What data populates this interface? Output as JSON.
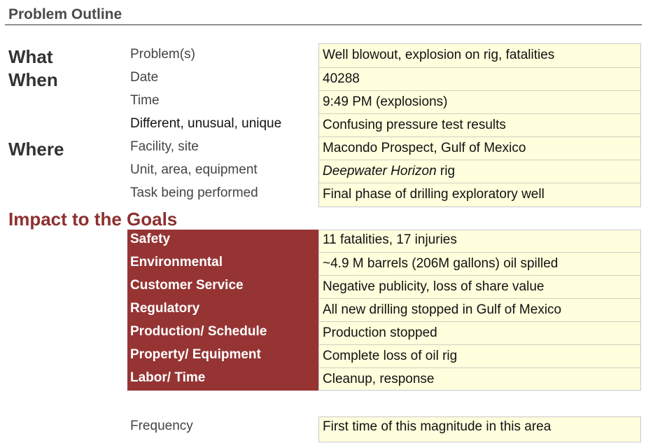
{
  "title": "Problem Outline",
  "sections": {
    "what": "What",
    "when": "When",
    "where": "Where"
  },
  "outline": [
    {
      "label": "Problem(s)",
      "value": "Well blowout, explosion on rig, fatalities"
    },
    {
      "label": "Date",
      "value": "40288"
    },
    {
      "label": "Time",
      "value": "9:49 PM (explosions)"
    },
    {
      "label": "Different, unusual, unique",
      "value": "Confusing pressure test results"
    },
    {
      "label": "Facility, site",
      "value": "Macondo Prospect, Gulf of Mexico"
    },
    {
      "label": "Unit, area, equipment",
      "value_italic": "Deepwater Horizon",
      "value": " rig"
    },
    {
      "label": "Task being performed",
      "value": "Final phase of drilling exploratory well"
    }
  ],
  "goals_heading": "Impact to the Goals",
  "goals": [
    {
      "label": "Safety",
      "value": "11 fatalities, 17 injuries"
    },
    {
      "label": "Environmental",
      "value": "~4.9 M barrels (206M gallons) oil spilled"
    },
    {
      "label": "Customer Service",
      "value": "Negative publicity, loss of share value"
    },
    {
      "label": "Regulatory",
      "value": "All new drilling stopped in Gulf of Mexico"
    },
    {
      "label": "Production/ Schedule",
      "value": "Production stopped"
    },
    {
      "label": "Property/ Equipment",
      "value": "Complete loss of oil rig"
    },
    {
      "label": "Labor/ Time",
      "value": "Cleanup, response"
    }
  ],
  "frequency": {
    "label": "Frequency",
    "value": "First time of this magnitude in this area"
  },
  "colors": {
    "accent": "#963434",
    "heading_red": "#8e2f2f",
    "value_fill": "#ffffdd"
  }
}
